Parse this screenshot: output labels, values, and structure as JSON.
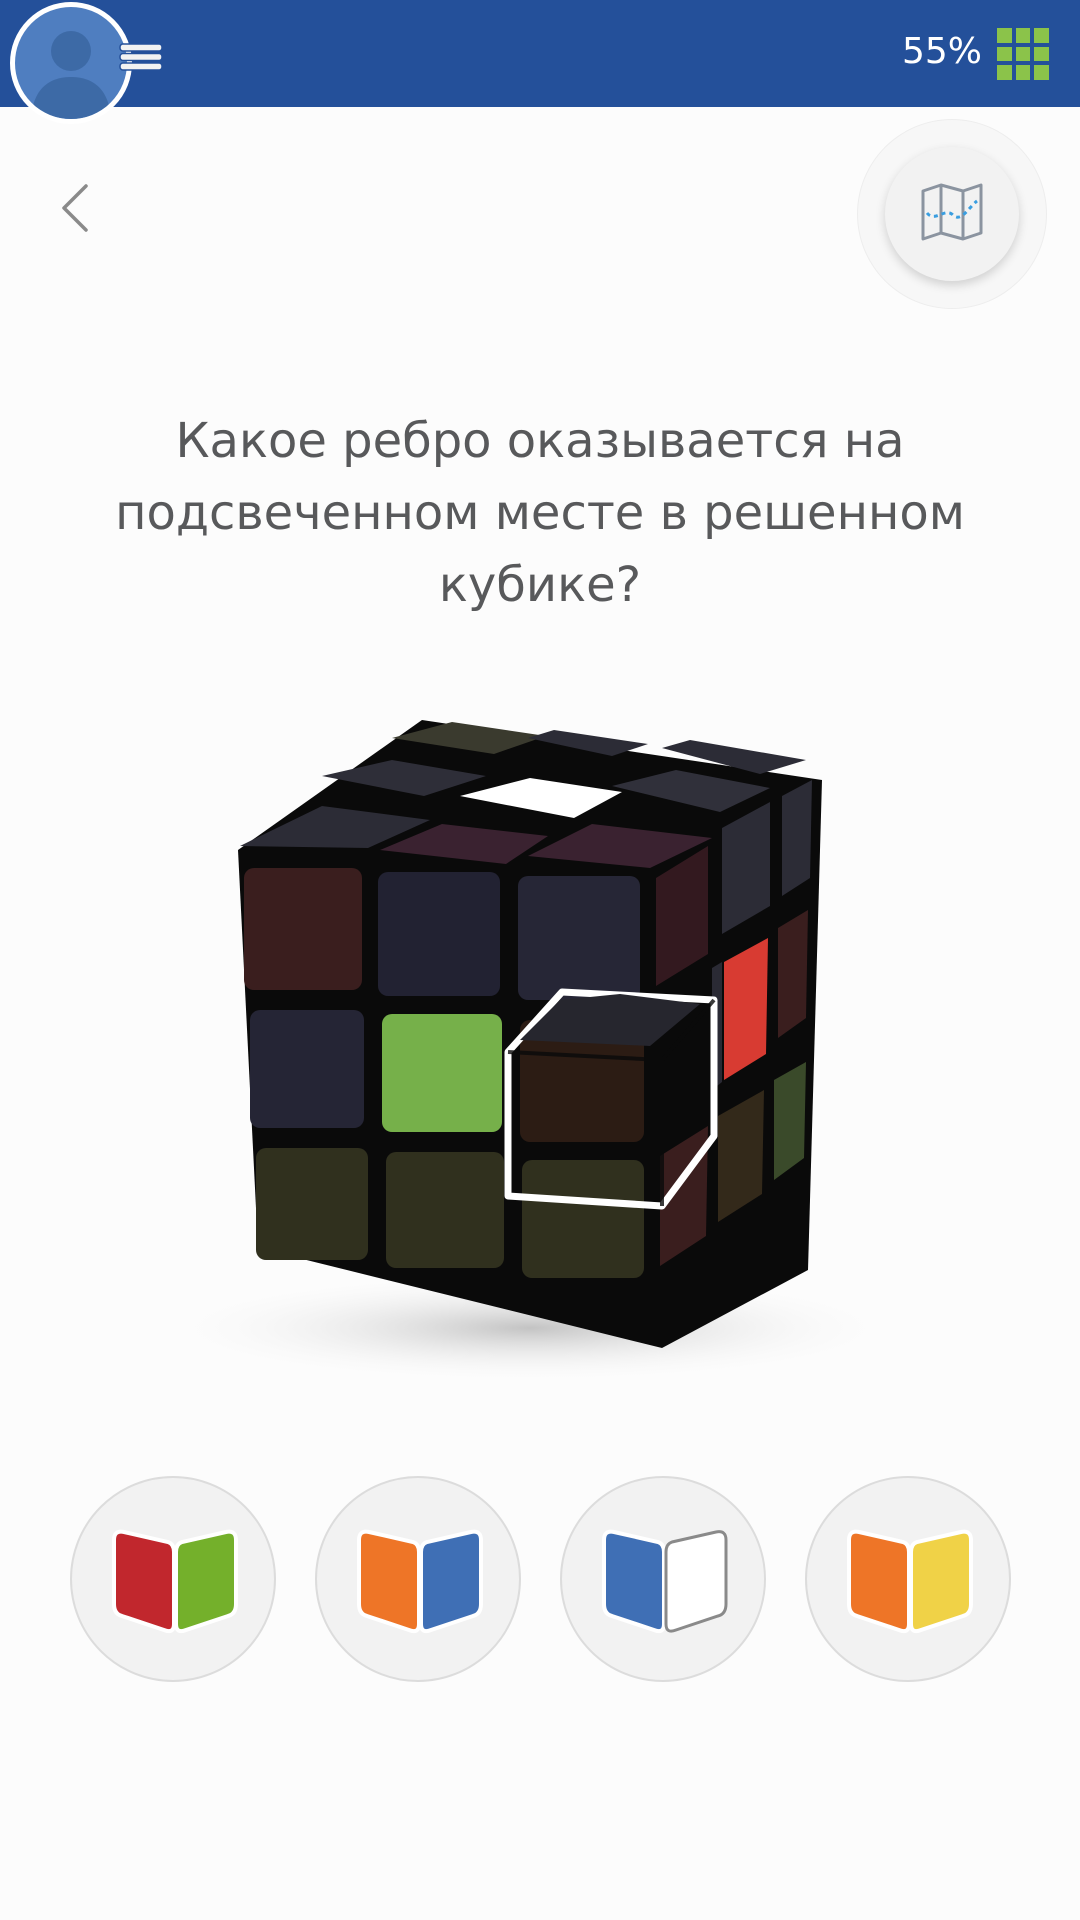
{
  "header": {
    "progress_text": "55%",
    "icons": [
      "avatar-icon",
      "menu-icon",
      "grid-icon"
    ],
    "grid_color": "#8bc34a",
    "bar_color": "#24509a"
  },
  "nav": {
    "back_icon": "chevron-left-icon",
    "map_icon": "map-icon"
  },
  "question": {
    "text": "Какое ребро оказывается на подсвеченном месте в решенном кубике?"
  },
  "cube": {
    "highlight_color": "#ffffff",
    "front_face": [
      [
        "#3a1e1e",
        "#222232",
        "#262636"
      ],
      [
        "#252535",
        "#76b04a",
        "#2c1c14"
      ],
      [
        "#30301e",
        "#30301e",
        "#30301e"
      ]
    ],
    "right_face_visible_red": "#d83b32",
    "top_center": "#ffffff"
  },
  "answers": [
    {
      "left_color": "#c1272d",
      "right_color": "#74b02b"
    },
    {
      "left_color": "#ee7527",
      "right_color": "#3f6fb5"
    },
    {
      "left_color": "#3f6fb5",
      "right_color": "#ffffff"
    },
    {
      "left_color": "#ee7527",
      "right_color": "#f0d247"
    }
  ]
}
